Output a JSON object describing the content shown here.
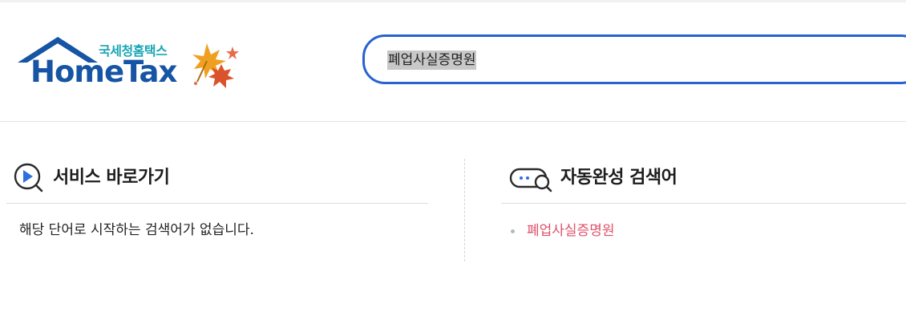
{
  "header": {
    "logo_korean": "국세청홈택스",
    "logo_english": "HomeTax",
    "search_value": "폐업사실증명원",
    "colors": {
      "brand_blue": "#1654a4",
      "brand_teal": "#1ba6b5",
      "search_border": "#2762d0"
    }
  },
  "service_shortcut": {
    "title": "서비스 바로가기",
    "empty_message": "해당 단어로 시작하는 검색어가 없습니다.",
    "icon": "play-search-icon"
  },
  "autocomplete": {
    "title": "자동완성 검색어",
    "icon": "chat-search-icon",
    "items": [
      {
        "label": "폐업사실증명원"
      }
    ],
    "colors": {
      "item_text": "#e0506a"
    }
  }
}
